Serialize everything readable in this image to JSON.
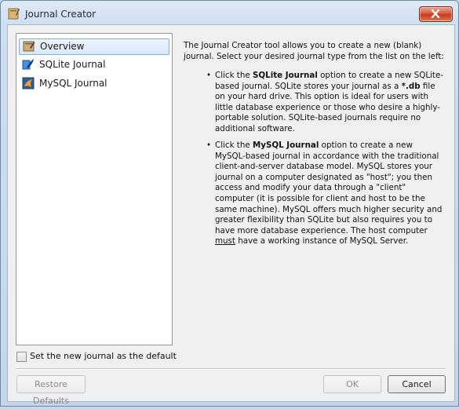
{
  "window": {
    "title": "Journal Creator"
  },
  "sidebar": {
    "items": [
      {
        "label": "Overview",
        "icon": "overview-icon",
        "selected": true
      },
      {
        "label": "SQLite Journal",
        "icon": "sqlite-icon",
        "selected": false
      },
      {
        "label": "MySQL Journal",
        "icon": "mysql-icon",
        "selected": false
      }
    ]
  },
  "content": {
    "intro": "The Journal Creator tool allows you to create a new (blank) journal. Select your desired journal type from the list on the left:",
    "sqlite": {
      "prefix": "Click the ",
      "name": "SQLite Journal",
      "mid": " option to create a new SQLite-based journal. SQLite stores your journal as a ",
      "ext": "*.db",
      "rest": " file on your hard drive. This option is ideal for users with little database experience or those who desire a highly-portable solution. SQLite-based journals require no additional software."
    },
    "mysql": {
      "prefix": "Click the ",
      "name": "MySQL Journal",
      "rest1": " option to create a new MySQL-based journal in accordance with the traditional client-and-server database model. MySQL stores your journal on a computer designated as \"host\"; you then access and modify your data through a \"client\" computer (it is possible for client and host to be the same machine). MySQL offers much higher security and greater flexibility than SQLite but also requires you to have more database experience. The host computer ",
      "must": "must",
      "rest2": " have a working instance of MySQL Server."
    }
  },
  "default_checkbox": {
    "label": "Set the new journal as the default",
    "checked": false
  },
  "buttons": {
    "restore": "Restore Defaults",
    "ok": "OK",
    "cancel": "Cancel"
  },
  "colors": {
    "selection_border": "#84acdd",
    "close_red": "#c7381f",
    "sqlite_blue": "#2a7fd4",
    "mysql_orange": "#e48e1e"
  }
}
